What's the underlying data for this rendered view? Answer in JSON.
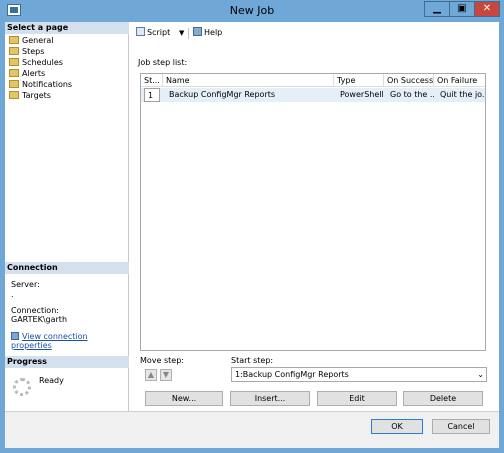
{
  "window": {
    "title": "New Job"
  },
  "left": {
    "select_page_header": "Select a page",
    "pages": [
      "General",
      "Steps",
      "Schedules",
      "Alerts",
      "Notifications",
      "Targets"
    ],
    "connection_header": "Connection",
    "server_label": "Server:",
    "server_value": ".",
    "connection_label": "Connection:",
    "connection_value": "GARTEK\\garth",
    "view_props_link": "View connection properties",
    "progress_header": "Progress",
    "progress_status": "Ready"
  },
  "toolbar": {
    "script_label": "Script",
    "help_label": "Help"
  },
  "steps": {
    "list_label": "Job step list:",
    "columns": [
      "St...",
      "Name",
      "Type",
      "On Success",
      "On Failure"
    ],
    "rows": [
      {
        "step": "1",
        "name": "Backup ConfigMgr Reports",
        "type": "PowerShell",
        "on_success": "Go to the ...",
        "on_failure": "Quit the jo..."
      }
    ]
  },
  "move_step_label": "Move step:",
  "start_step_label": "Start step:",
  "start_step_value": "1:Backup ConfigMgr Reports",
  "buttons": {
    "new": "New...",
    "insert": "Insert...",
    "edit": "Edit",
    "delete": "Delete",
    "ok": "OK",
    "cancel": "Cancel"
  }
}
